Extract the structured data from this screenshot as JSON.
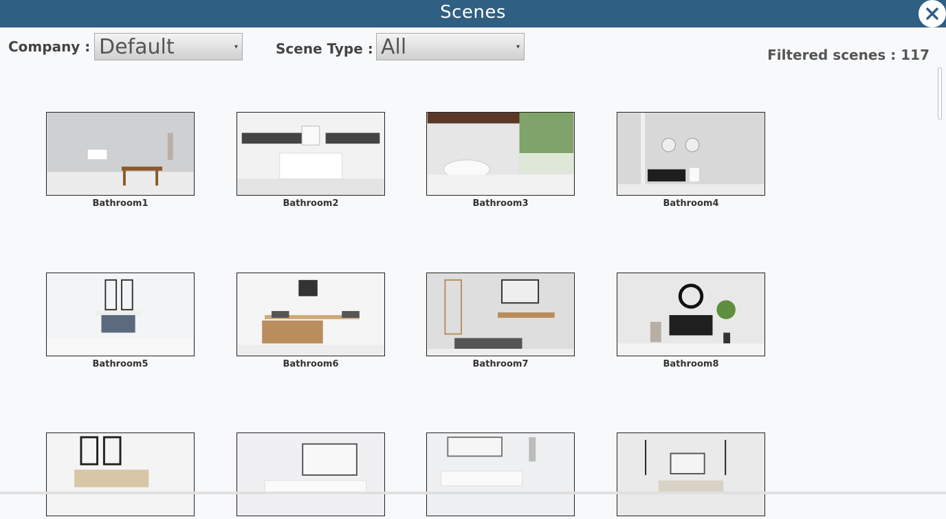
{
  "window": {
    "title": "Scenes"
  },
  "filters": {
    "company_label": "Company :",
    "company_value": "Default",
    "scene_type_label": "Scene Type :",
    "scene_type_value": "All"
  },
  "filtered": {
    "text": "Filtered scenes : 117"
  },
  "scenes": [
    {
      "label": "Bathroom1"
    },
    {
      "label": "Bathroom2"
    },
    {
      "label": "Bathroom3"
    },
    {
      "label": "Bathroom4"
    },
    {
      "label": "Bathroom5"
    },
    {
      "label": "Bathroom6"
    },
    {
      "label": "Bathroom7"
    },
    {
      "label": "Bathroom8"
    },
    {
      "label": ""
    },
    {
      "label": ""
    },
    {
      "label": ""
    },
    {
      "label": ""
    }
  ],
  "icons": {
    "close": "close-icon",
    "dropdown": "chevron-down-icon"
  },
  "colors": {
    "titlebar": "#2f5f82",
    "background": "#f8f9fb"
  }
}
